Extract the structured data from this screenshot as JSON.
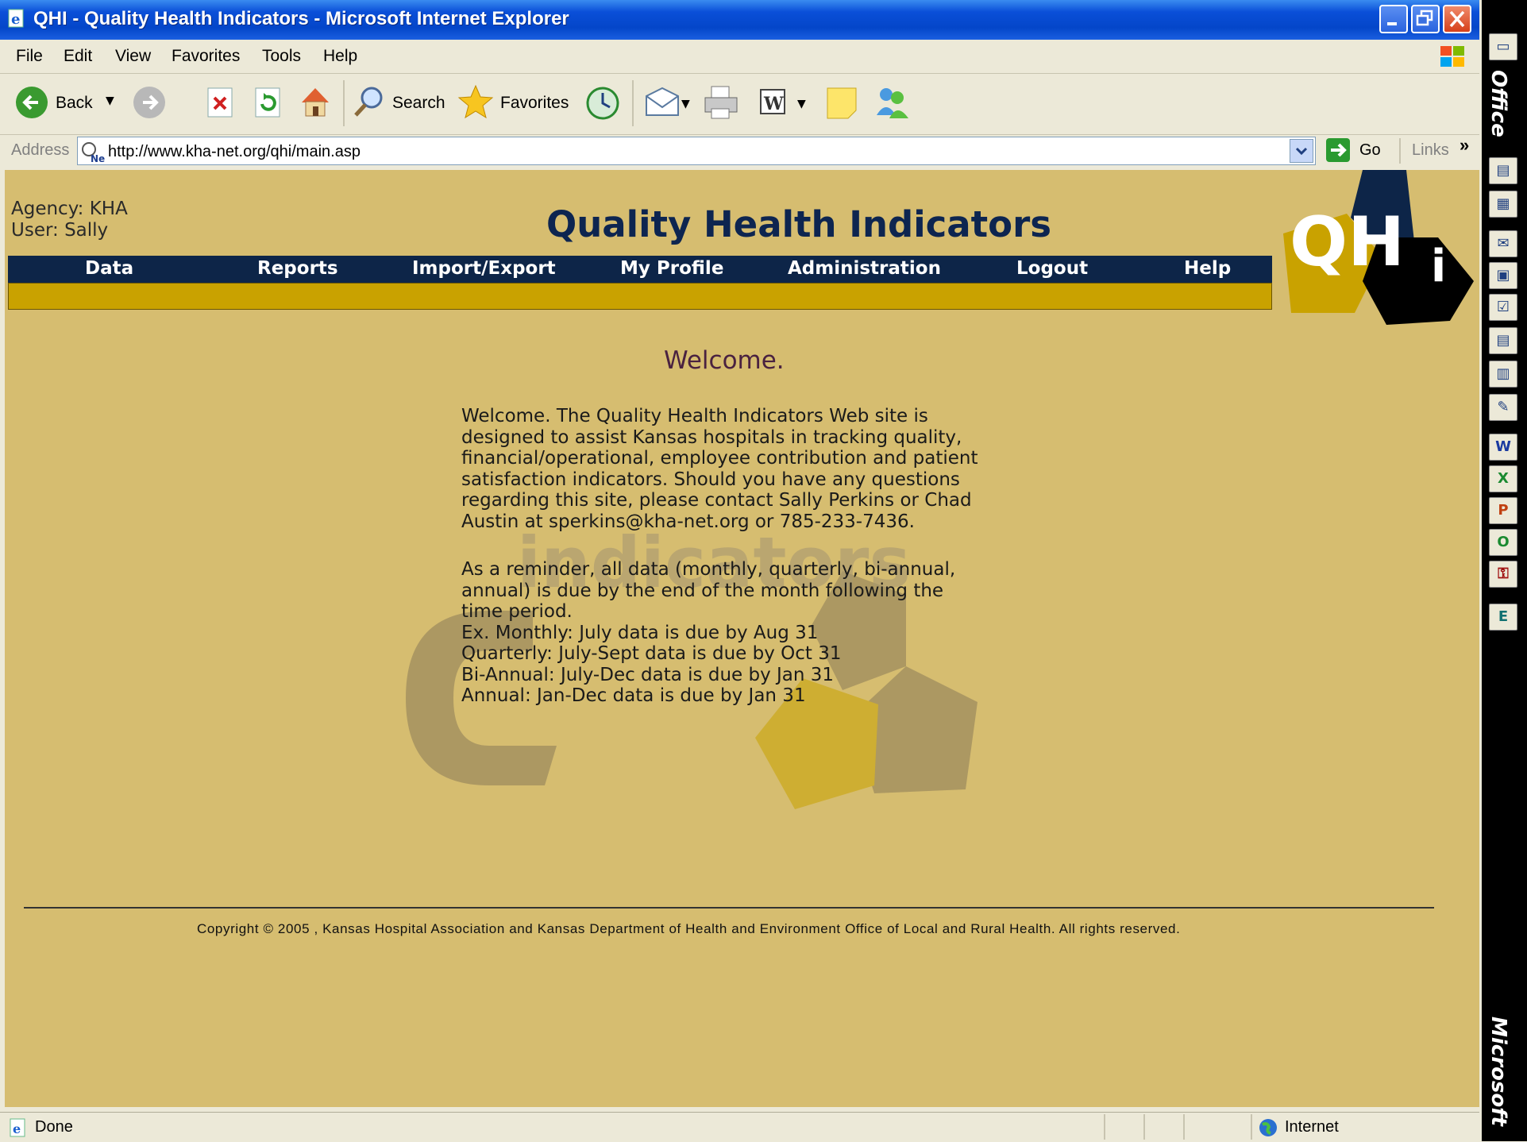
{
  "window": {
    "title": "QHI - Quality Health Indicators - Microsoft Internet Explorer"
  },
  "menu": [
    "File",
    "Edit",
    "View",
    "Favorites",
    "Tools",
    "Help"
  ],
  "toolbar": {
    "back_label": "Back",
    "search_label": "Search",
    "favorites_label": "Favorites"
  },
  "address": {
    "label": "Address",
    "url": "http://www.kha-net.org/qhi/main.asp",
    "go_label": "Go",
    "links_label": "Links",
    "more": "»"
  },
  "site": {
    "agency": "Agency: KHA",
    "user": "User: Sally",
    "title": "Quality Health Indicators",
    "logo_text": "QH",
    "logo_sub": "i",
    "watermark_text": "indicators"
  },
  "nav": [
    "Data",
    "Reports",
    "Import/Export",
    "My Profile",
    "Administration",
    "Logout",
    "Help"
  ],
  "content": {
    "welcome_heading": "Welcome.",
    "intro_lines": [
      "Welcome. The Quality Health Indicators Web site is",
      "designed to assist Kansas hospitals in tracking quality,",
      "financial/operational, employee contribution and patient",
      "satisfaction indicators. Should you have any questions",
      "regarding this site, please contact Sally Perkins or Chad",
      "Austin at sperkins@kha-net.org or 785-233-7436."
    ],
    "reminder_lines": [
      "As a reminder, all data (monthly, quarterly, bi-annual,",
      "annual) is due by the end of the month following the",
      "time period.",
      "Ex. Monthly: July data is due by Aug 31",
      "Quarterly: July-Sept data is due by Oct 31",
      "Bi-Annual: July-Dec data is due by Jan 31",
      "Annual: Jan-Dec data is due by Jan 31"
    ]
  },
  "footer": {
    "copyright": "Copyright © 2005 , Kansas Hospital Association and Kansas Department of Health and Environment Office of Local and Rural Health. All rights reserved."
  },
  "status": {
    "text": "Done",
    "zone": "Internet"
  },
  "officebar": {
    "top_label": "Office",
    "bottom_label": "Microsoft"
  },
  "colors": {
    "page_bg": "#d6bd70",
    "nav_bg": "#0d2548",
    "gold_bar": "#c9a200",
    "title_color": "#0d2550"
  }
}
